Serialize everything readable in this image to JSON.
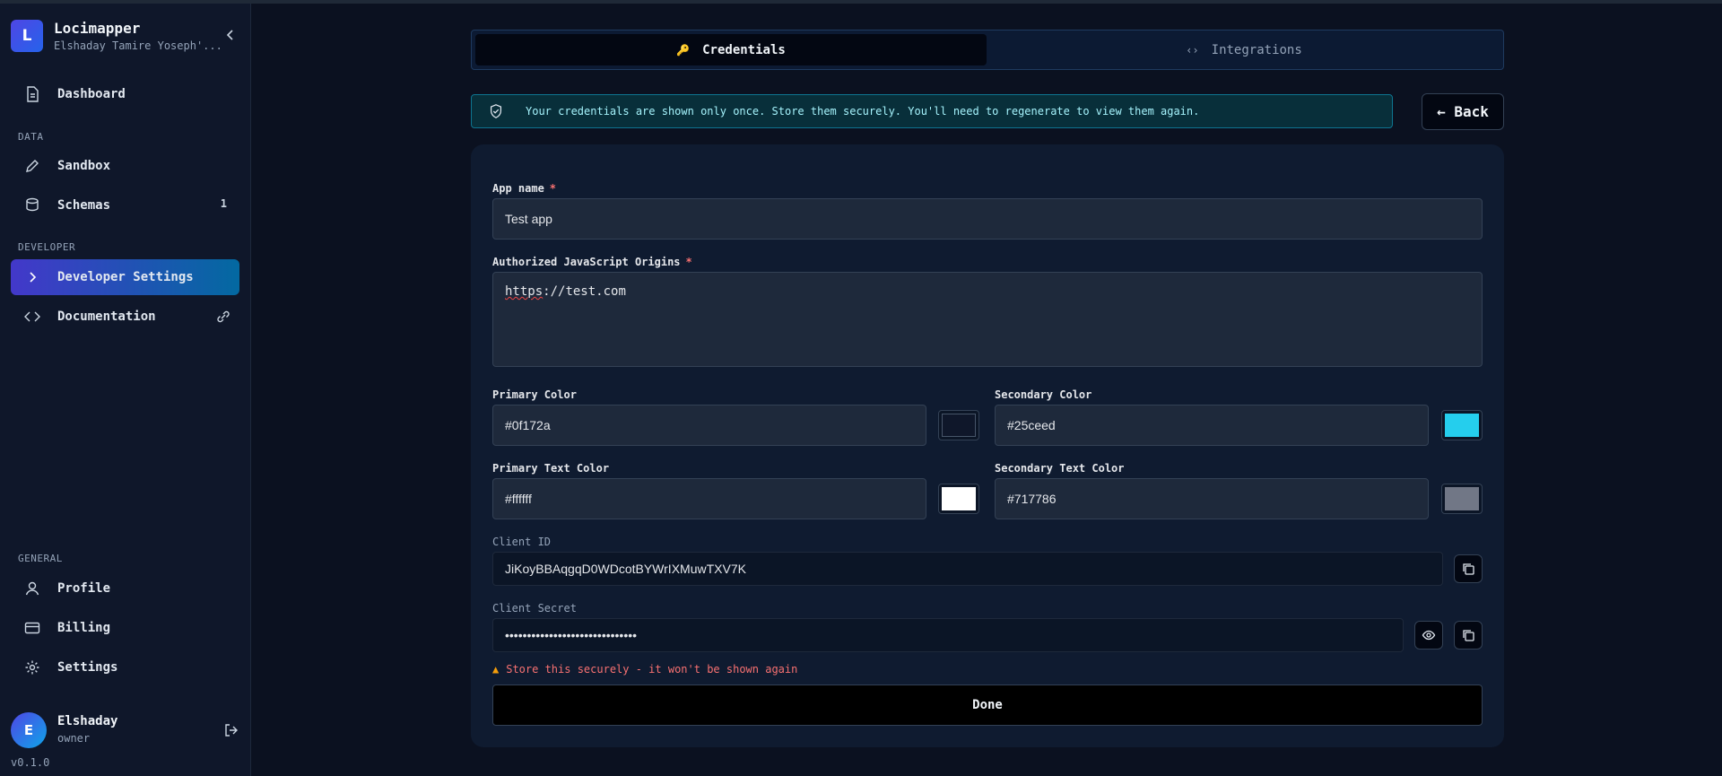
{
  "app": {
    "name": "Locimapper",
    "org": "Elshaday Tamire Yoseph'..."
  },
  "sidebar": {
    "dashboard": "Dashboard",
    "section_data": "DATA",
    "sandbox": "Sandbox",
    "schemas": "Schemas",
    "schemas_count": "1",
    "section_developer": "DEVELOPER",
    "developer_settings": "Developer Settings",
    "documentation": "Documentation",
    "section_general": "GENERAL",
    "profile": "Profile",
    "billing": "Billing",
    "settings": "Settings"
  },
  "user": {
    "initial": "E",
    "name": "Elshaday",
    "role": "owner"
  },
  "version": "v0.1.0",
  "tabs": {
    "credentials": "Credentials",
    "integrations": "Integrations",
    "credentials_icon": "🔑",
    "integrations_icon": "‹›"
  },
  "alert": {
    "text": "Your credentials are shown only once. Store them securely. You'll need to regenerate to view them again."
  },
  "back_label": "← Back",
  "form": {
    "app_name_label": "App name",
    "app_name_value": "Test app",
    "required_mark": "*",
    "origins_label": "Authorized JavaScript Origins",
    "origins_scheme": "https",
    "origins_rest": "://test.com",
    "primary_color_label": "Primary Color",
    "primary_color_value": "#0f172a",
    "secondary_color_label": "Secondary Color",
    "secondary_color_value": "#25ceed",
    "primary_text_color_label": "Primary Text Color",
    "primary_text_color_value": "#ffffff",
    "secondary_text_color_label": "Secondary Text Color",
    "secondary_text_color_value": "#717786",
    "client_id_label": "Client ID",
    "client_id_value": "JiKoyBBAqgqD0WDcotBYWrIXMuwTXV7K",
    "client_secret_label": "Client Secret",
    "client_secret_value": "••••••••••••••••••••••••••••••",
    "warning": "Store this securely - it won't be shown again",
    "warning_icon": "▲",
    "done_label": "Done"
  },
  "colors": {
    "accent": "#4338ca",
    "cyan": "#25ceed",
    "danger": "#f87171"
  }
}
